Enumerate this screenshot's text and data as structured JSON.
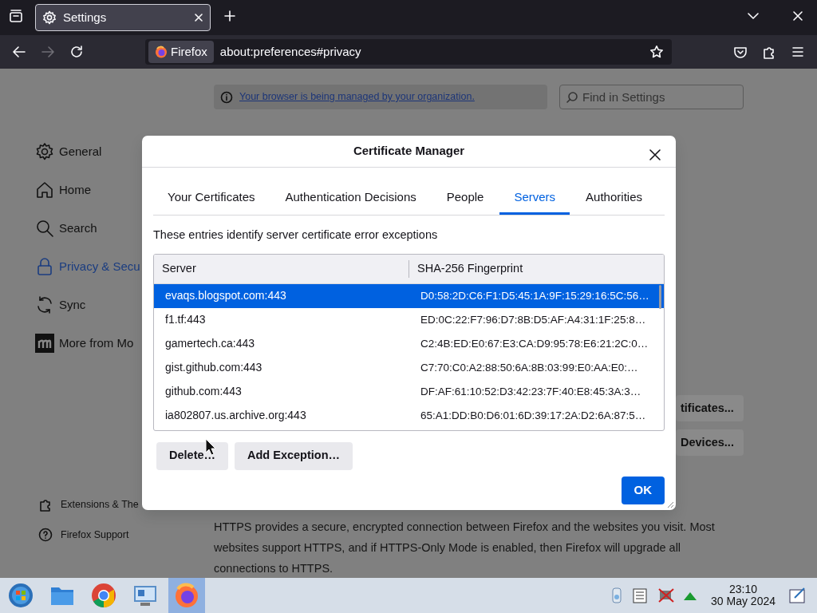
{
  "browser": {
    "tabs": [
      {
        "title": "Settings",
        "selected": true
      }
    ],
    "identity": "Firefox",
    "url": "about:preferences#privacy",
    "forward_disabled": true
  },
  "page": {
    "policy_notice": "Your browser is being managed by your organization.",
    "search": {
      "placeholder": "Find in Settings"
    },
    "sidebar": [
      {
        "kind": "gear",
        "label": "General",
        "selected": false
      },
      {
        "kind": "home",
        "label": "Home",
        "selected": false
      },
      {
        "kind": "search",
        "label": "Search",
        "selected": false
      },
      {
        "kind": "lock",
        "label": "Privacy & Secu",
        "selected": true
      },
      {
        "kind": "sync",
        "label": "Sync",
        "selected": false
      },
      {
        "kind": "mozilla",
        "label": "More from Mo",
        "selected": false
      }
    ],
    "sidebar_footer": [
      {
        "kind": "puzzle",
        "label": "Extensions & The"
      },
      {
        "kind": "help",
        "label": "Firefox Support"
      }
    ],
    "buttons": [
      "tificates...",
      "Devices..."
    ],
    "https_text": "HTTPS provides a secure, encrypted connection between Firefox and the websites you visit. Most websites support HTTPS, and if HTTPS-Only Mode is enabled, then Firefox will upgrade all connections to HTTPS."
  },
  "dialog": {
    "title": "Certificate Manager",
    "tabs": [
      {
        "label": "Your Certificates",
        "selected": false
      },
      {
        "label": "Authentication Decisions",
        "selected": false
      },
      {
        "label": "People",
        "selected": false
      },
      {
        "label": "Servers",
        "selected": true
      },
      {
        "label": "Authorities",
        "selected": false
      }
    ],
    "description": "These entries identify server certificate error exceptions",
    "columns": [
      "Server",
      "SHA-256 Fingerprint"
    ],
    "rows": [
      {
        "server": "evaqs.blogspot.com:443",
        "fingerprint": "D0:58:2D:C6:F1:D5:45:1A:9F:15:29:16:5C:56…",
        "selected": true
      },
      {
        "server": "f1.tf:443",
        "fingerprint": "ED:0C:22:F7:96:D7:8B:D5:AF:A4:31:1F:25:8…",
        "selected": false
      },
      {
        "server": "gamertech.ca:443",
        "fingerprint": "C2:4B:ED:E0:67:E3:CA:D9:95:78:E6:21:2C:0…",
        "selected": false
      },
      {
        "server": "gist.github.com:443",
        "fingerprint": "C7:70:C0:A2:88:50:6A:8B:03:99:E0:AA:E0:…",
        "selected": false
      },
      {
        "server": "github.com:443",
        "fingerprint": "DF:AF:61:10:52:D3:42:23:7F:40:E8:45:3A:3…",
        "selected": false
      },
      {
        "server": "ia802807.us.archive.org:443",
        "fingerprint": "65:A1:DD:B0:D6:01:6D:39:17:2A:D2:6A:87:5…",
        "selected": false
      }
    ],
    "buttons": [
      "Delete…",
      "Add Exception…"
    ],
    "ok": "OK"
  },
  "taskbar": {
    "apps": [
      {
        "kind": "start",
        "selected": false
      },
      {
        "kind": "files",
        "selected": false
      },
      {
        "kind": "chrome",
        "selected": false
      },
      {
        "kind": "monitor",
        "selected": false
      },
      {
        "kind": "firefox",
        "selected": true
      }
    ],
    "time": "23:10",
    "date": "30 May 2024"
  }
}
